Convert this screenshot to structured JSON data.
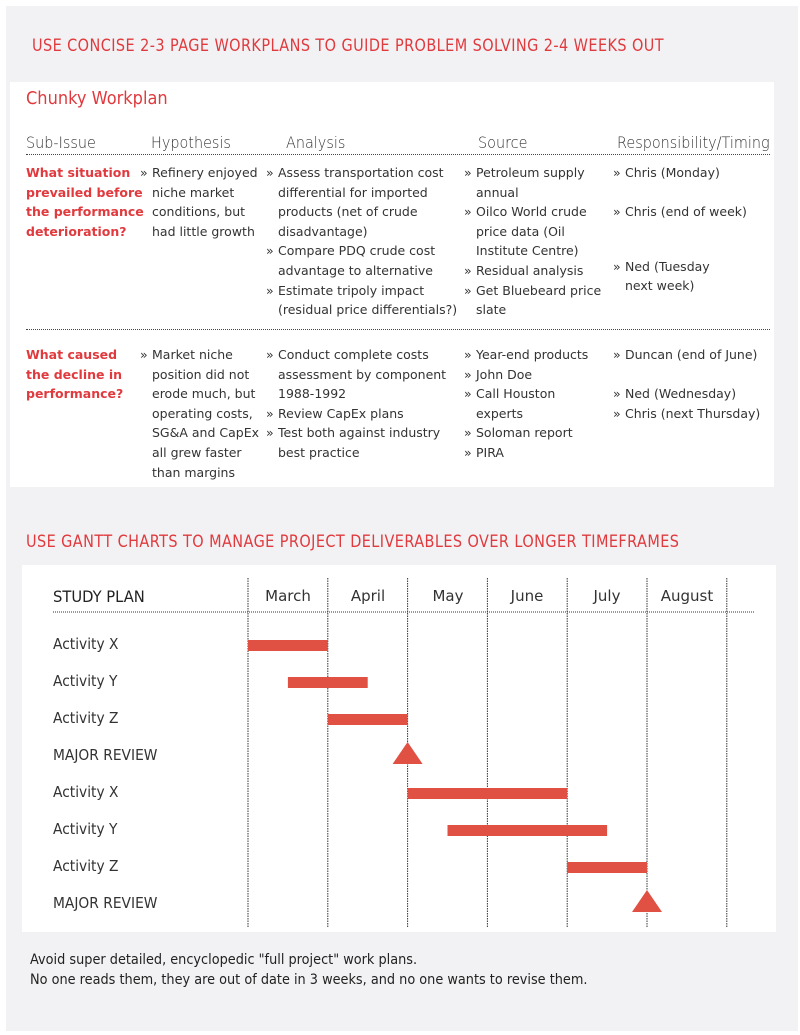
{
  "headings": {
    "workplan_section": "USE CONCISE 2-3 PAGE WORKPLANS TO GUIDE PROBLEM SOLVING 2-4 WEEKS OUT",
    "gantt_section": "USE GANTT CHARTS TO MANAGE PROJECT DELIVERABLES OVER LONGER TIMEFRAMES"
  },
  "workplan": {
    "title": "Chunky Workplan",
    "columns": [
      "Sub-Issue",
      "Hypothesis",
      "Analysis",
      "Source",
      "Responsibility/Timing"
    ],
    "bullet": "»",
    "rows": [
      {
        "sub_issue": [
          "What situation",
          "prevailed before",
          "the performance",
          "deterioration?"
        ],
        "hypothesis": [
          [
            "Refinery enjoyed",
            "niche market",
            "conditions, but",
            "had little growth"
          ]
        ],
        "analysis": [
          [
            "Assess transportation cost",
            "differential for imported",
            "products (net of crude",
            "disadvantage)"
          ],
          [
            "Compare PDQ crude cost",
            "advantage to alternative"
          ],
          [
            "Estimate tripoly impact",
            "(residual price differentials?)"
          ]
        ],
        "source": [
          [
            "Petroleum supply",
            "annual"
          ],
          [
            "Oilco World crude",
            "price data (Oil",
            "Institute Centre)"
          ],
          [
            "Residual analysis"
          ],
          [
            "Get Bluebeard price",
            "slate"
          ]
        ],
        "responsibility": [
          [
            "Chris (Monday)"
          ],
          [
            "Chris (end of week)"
          ],
          [
            "Ned (Tuesday",
            "next week)"
          ]
        ]
      },
      {
        "sub_issue": [
          "What caused",
          "the decline in",
          "performance?"
        ],
        "hypothesis": [
          [
            "Market niche",
            "position did not",
            "erode much, but",
            "operating costs,",
            "SG&A and CapEx",
            "all grew faster",
            "than margins"
          ]
        ],
        "analysis": [
          [
            "Conduct complete costs",
            "assessment by component",
            "1988-1992"
          ],
          [
            "Review CapEx plans"
          ],
          [
            "Test both against industry",
            "best practice"
          ]
        ],
        "source": [
          [
            "Year-end products"
          ],
          [
            "John Doe"
          ],
          [
            "Call Houston",
            "experts"
          ],
          [
            "Soloman report"
          ],
          [
            "PIRA"
          ]
        ],
        "responsibility": [
          [
            "Duncan (end of June)"
          ],
          [
            "Ned (Wednesday)"
          ],
          [
            "Chris (next Thursday)"
          ]
        ]
      }
    ]
  },
  "chart_data": {
    "type": "gantt",
    "title": "STUDY PLAN",
    "categories": [
      "March",
      "April",
      "May",
      "June",
      "July",
      "August"
    ],
    "units": "months from start of March",
    "tasks": [
      {
        "label": "Activity X",
        "kind": "bar",
        "start": 0,
        "end": 1
      },
      {
        "label": "Activity Y",
        "kind": "bar",
        "start": 0.5,
        "end": 1.5
      },
      {
        "label": "Activity Z",
        "kind": "bar",
        "start": 1,
        "end": 2
      },
      {
        "label": "MAJOR REVIEW",
        "kind": "milestone",
        "at": 2
      },
      {
        "label": "Activity X",
        "kind": "bar",
        "start": 2,
        "end": 4
      },
      {
        "label": "Activity Y",
        "kind": "bar",
        "start": 2.5,
        "end": 4.5
      },
      {
        "label": "Activity Z",
        "kind": "bar",
        "start": 4,
        "end": 5
      },
      {
        "label": "MAJOR REVIEW",
        "kind": "milestone",
        "at": 5
      }
    ],
    "colors": {
      "bar": "#e05043",
      "milestone": "#e05043",
      "grid": "#333333"
    }
  },
  "footer": {
    "line1": "Avoid super detailed, encyclopedic \"full project\" work plans.",
    "line2": "No one reads them, they are out of date in 3 weeks, and no one wants to revise them."
  },
  "colors": {
    "accent": "#e03a3e",
    "background": "#f2f2f4"
  }
}
